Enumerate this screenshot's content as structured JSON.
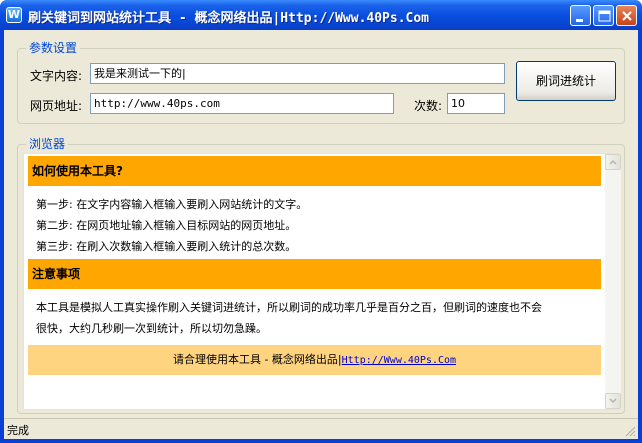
{
  "window": {
    "title": "刷关键词到网站统计工具 - 概念网络出品|Http://Www.40Ps.Com",
    "app_icon_letter": "W",
    "title_colors": {
      "bar": "#0a4fe0",
      "close": "#c8421a"
    }
  },
  "params": {
    "legend": "参数设置",
    "text_label": "文字内容:",
    "text_value": "我是来测试一下的|",
    "url_label": "网页地址:",
    "url_value": "http://www.40ps.com",
    "count_label": "次数:",
    "count_value": "10",
    "submit_label": "刷词进统计"
  },
  "browser": {
    "legend": "浏览器",
    "howto_title": "如何使用本工具?",
    "steps": [
      "第一步: 在文字内容输入框输入要刷入网站统计的文字。",
      "第二步: 在网页地址输入框输入目标网站的网页地址。",
      "第三步: 在刷入次数输入框输入要刷入统计的总次数。"
    ],
    "notice_title": "注意事项",
    "notice_lines": [
      "本工具是模拟人工真实操作刷入关键词进统计，所以刷词的成功率几乎是百分之百，但刷词的速度也不会",
      "很快，大约几秒刷一次到统计，所以切勿急躁。"
    ],
    "footer_text": "请合理使用本工具 - 概念网络出品|",
    "footer_link": "Http://Www.40Ps.Com",
    "accent_color": "#ffa600",
    "footer_color": "#ffd480"
  },
  "status": {
    "text": "完成"
  }
}
